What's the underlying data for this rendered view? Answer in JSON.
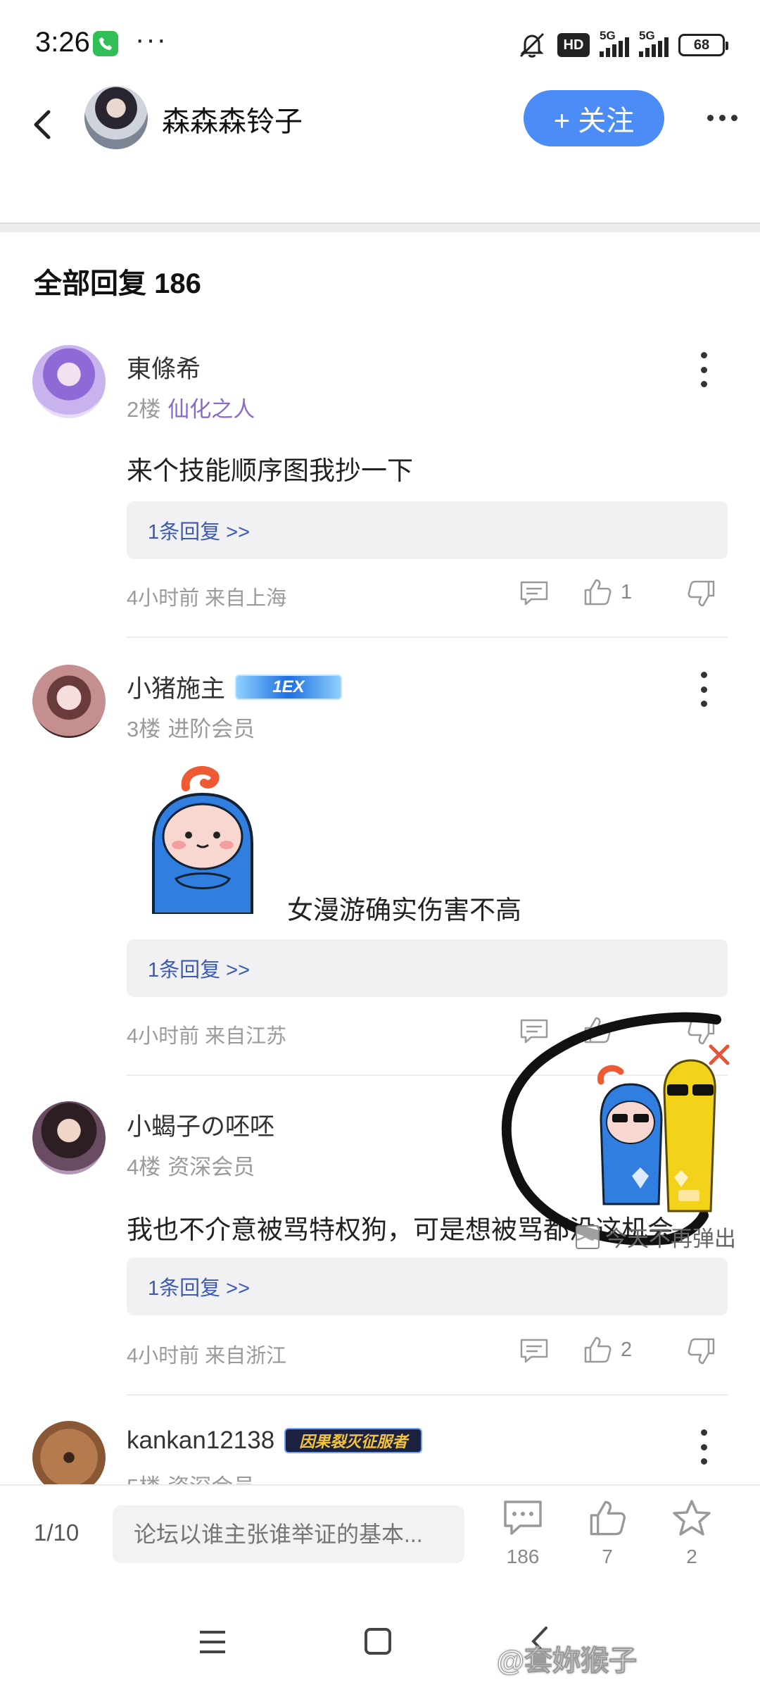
{
  "status_bar": {
    "time": "3:26",
    "dots": "···",
    "hd": "HD",
    "net1": "5G",
    "net2": "5G",
    "battery": "68"
  },
  "header": {
    "author_name": "森森森铃子",
    "follow_label": "+ 关注"
  },
  "section_title": "全部回复 186",
  "comments": [
    {
      "name": "東條希",
      "floor": "2楼",
      "title": "仙化之人",
      "text": "来个技能顺序图我抄一下",
      "reply_link": "1条回复 >>",
      "time_loc": "4小时前 来自上海",
      "likes": "1"
    },
    {
      "name": "小猪施主",
      "badge": "1EX",
      "floor": "3楼",
      "title": "进阶会员",
      "text": "女漫游确实伤害不高",
      "reply_link": "1条回复 >>",
      "time_loc": "4小时前 来自江苏",
      "likes": ""
    },
    {
      "name": "小蝎子の呸呸",
      "floor": "4楼",
      "title": "资深会员",
      "text": "我也不介意被骂特权狗，可是想被骂都没这机会",
      "reply_link": "1条回复 >>",
      "time_loc": "4小时前 来自浙江",
      "likes": "2"
    },
    {
      "name": "kankan12138",
      "badge": "因果裂灭征服者",
      "floor": "5楼",
      "title": "资深会员"
    }
  ],
  "popup": {
    "dont_show": "今天不再弹出"
  },
  "bottom_bar": {
    "page": "1/10",
    "input_placeholder": "论坛以谁主张谁举证的基本...",
    "comment_count": "186",
    "like_count": "7",
    "fav_count": "2"
  },
  "nav_bar": {
    "watermark": "@套妳猴子"
  },
  "colors": {
    "accent": "#4c8cf6",
    "link": "#3a5ab6",
    "title_purple": "#8a6bc7"
  }
}
